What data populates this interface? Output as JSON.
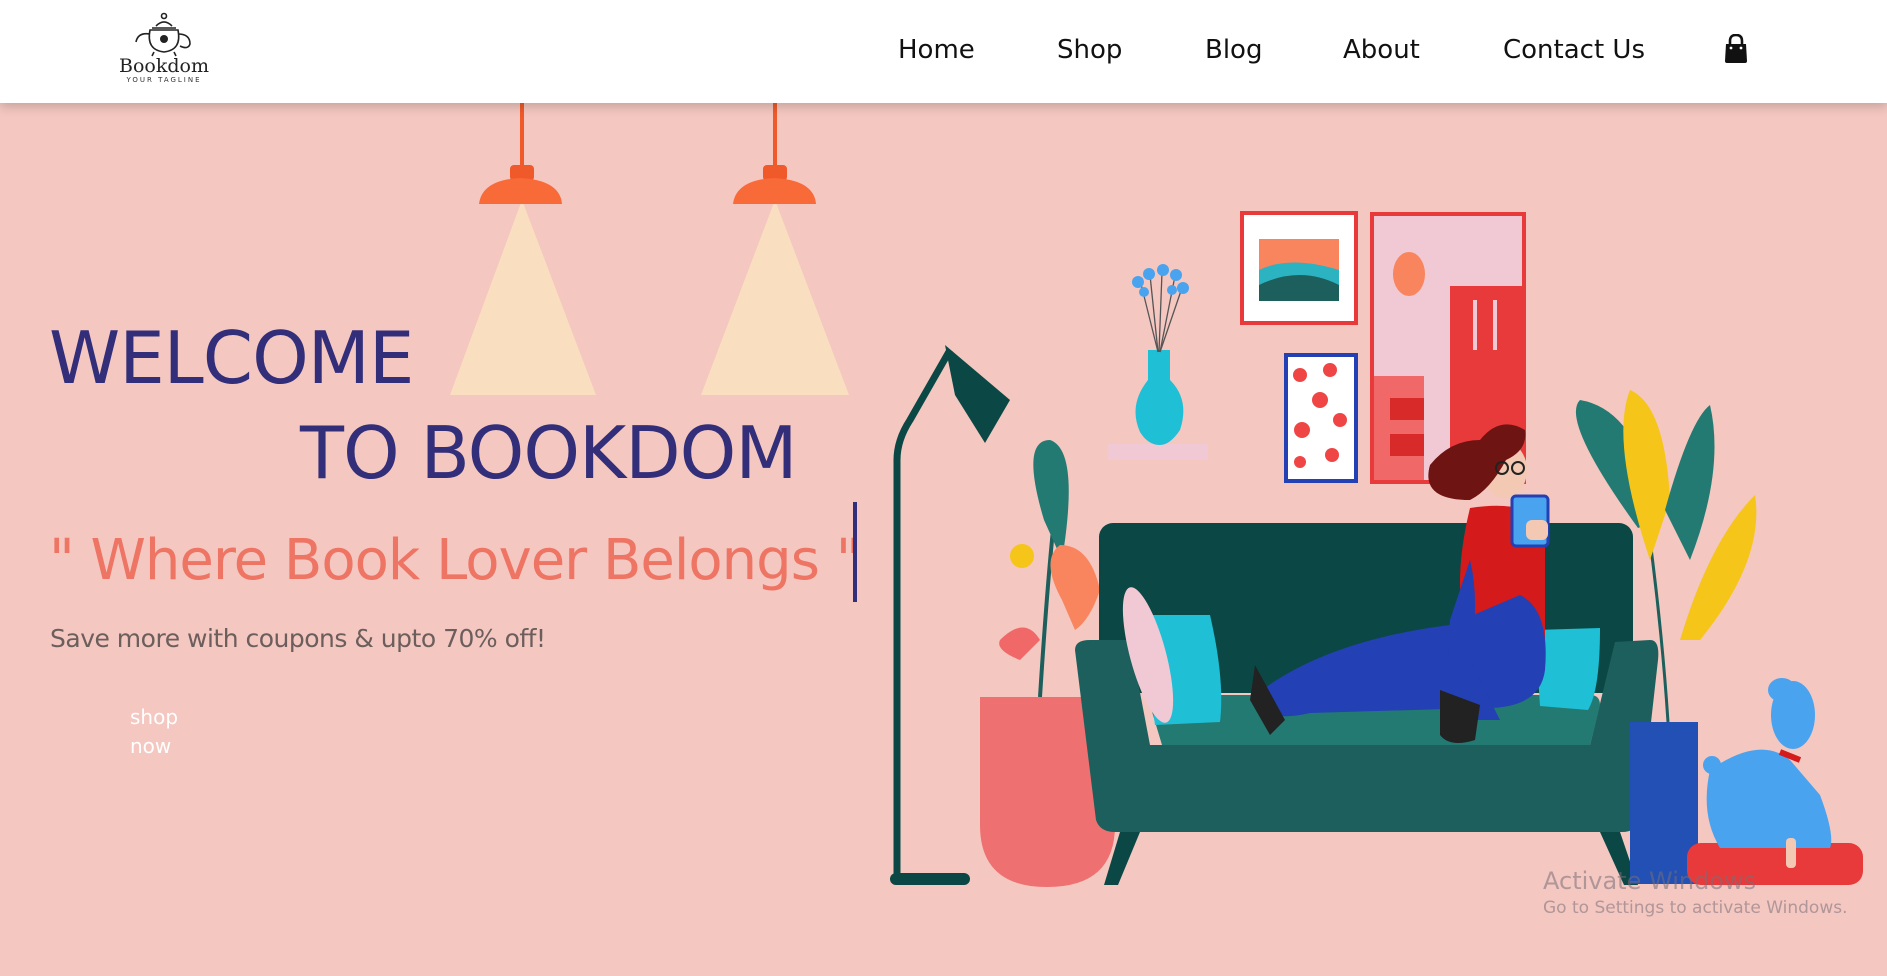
{
  "header": {
    "logo_name": "Bookdom",
    "logo_tagline": "YOUR TAGLINE",
    "nav": [
      {
        "label": "Home"
      },
      {
        "label": "Shop"
      },
      {
        "label": "Blog"
      },
      {
        "label": "About"
      },
      {
        "label": "Contact Us"
      }
    ],
    "cart_icon": "shopping-bag-icon"
  },
  "hero": {
    "line1": "WELCOME",
    "line2": "TO BOOKDOM",
    "tagline": "\" Where Book Lover Belongs \"",
    "subtitle": "Save more with coupons & upto 70% off!",
    "cta_label": "shop now",
    "illustration": "woman-reading-on-sofa-illustration"
  },
  "os_watermark": {
    "title": "Activate Windows",
    "subtitle": "Go to Settings to activate Windows."
  },
  "colors": {
    "background": "#f4c7c0",
    "heading": "#332e7a",
    "tagline": "#ee7464",
    "navbar": "#ffffff"
  }
}
